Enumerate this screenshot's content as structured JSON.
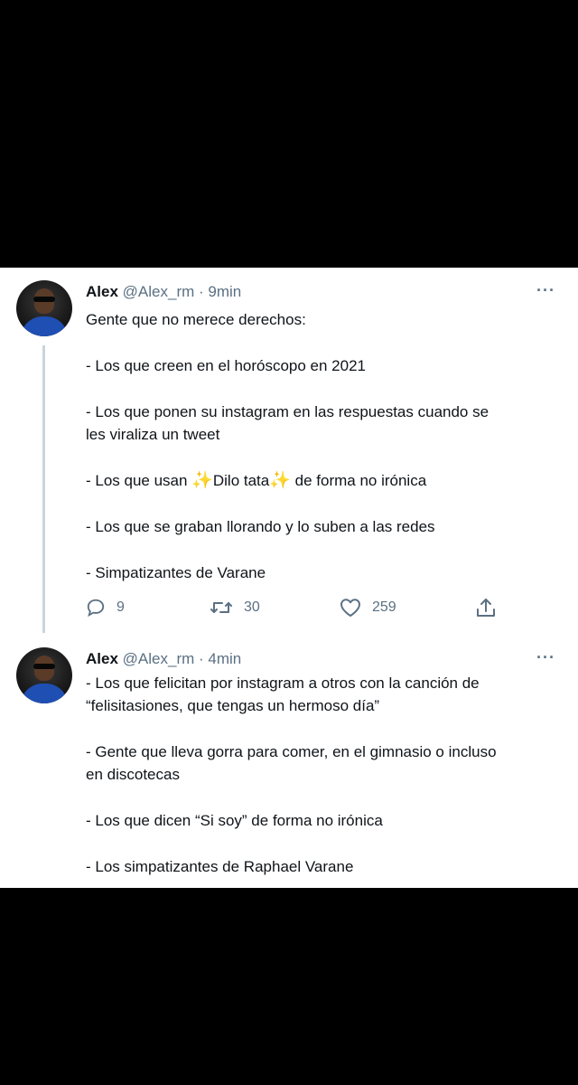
{
  "tweets": [
    {
      "name": "Alex",
      "handle": "@Alex_rm",
      "separator": "·",
      "time": "9min",
      "more_icon": "more-horizontal-icon",
      "lines": [
        "Gente que no merece derechos:",
        "",
        "- Los que creen en el horóscopo en 2021",
        "",
        "- Los que ponen su instagram en las respuestas cuando se",
        "les viraliza un tweet",
        "",
        "- Los que usan ✨Dilo tata✨ de forma no irónica",
        "",
        "- Los que se graban llorando y lo suben a las redes",
        "",
        "- Simpatizantes de Varane"
      ],
      "emoji_line": {
        "prefix": "- Los que usan ",
        "emoji": "✨",
        "middle": "Dilo tata",
        "suffix": " de forma no irónica"
      },
      "actions": {
        "reply_count": "9",
        "retweet_count": "30",
        "like_count": "259"
      }
    },
    {
      "name": "Alex",
      "handle": "@Alex_rm",
      "separator": "·",
      "time": "4min",
      "more_icon": "more-horizontal-icon",
      "lines": [
        "- Los que felicitan por instagram a otros con la canción de",
        "“felisitasiones, que tengas un hermoso día”",
        "",
        "- Gente que lleva gorra para comer, en el gimnasio o incluso",
        "en discotecas",
        "",
        "- Los que dicen “Si soy” de forma no irónica",
        "",
        "- Los simpatizantes de Raphael Varane"
      ]
    }
  ],
  "colors": {
    "background": "#000000",
    "card": "#ffffff",
    "text": "#0f1419",
    "secondary": "#5b7083",
    "thread_line": "#c9d5dd"
  }
}
